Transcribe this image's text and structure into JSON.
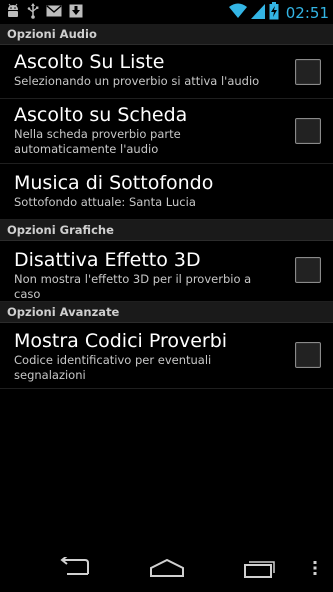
{
  "status_bar": {
    "time": "02:51",
    "icons": [
      "android-debug-icon",
      "usb-icon",
      "gmail-icon",
      "download-icon",
      "wifi-icon",
      "signal-icon",
      "battery-charging-icon"
    ]
  },
  "sections": {
    "audio": {
      "header": "Opzioni Audio",
      "items": [
        {
          "title": "Ascolto Su Liste",
          "summary": "Selezionando un proverbio si attiva l'audio",
          "checked": false
        },
        {
          "title": "Ascolto su Scheda",
          "summary": "Nella scheda proverbio parte automaticamente l'audio",
          "checked": false
        },
        {
          "title": "Musica di Sottofondo",
          "summary": "Sottofondo attuale: Santa Lucia"
        }
      ]
    },
    "graphics": {
      "header": "Opzioni Grafiche",
      "items": [
        {
          "title": "Disattiva Effetto 3D",
          "summary": "Non mostra l'effetto 3D per il proverbio a caso",
          "checked": false
        }
      ]
    },
    "advanced": {
      "header": "Opzioni Avanzate",
      "items": [
        {
          "title": "Mostra Codici Proverbi",
          "summary": "Codice identificativo per eventuali segnalazioni",
          "checked": false
        }
      ]
    }
  },
  "nav_bar": {
    "buttons": [
      "back-icon",
      "home-icon",
      "recents-icon",
      "overflow-menu-icon"
    ]
  },
  "colors": {
    "accent": "#33b5e5",
    "background": "#000000",
    "category_bg": "#1a1a1a"
  }
}
